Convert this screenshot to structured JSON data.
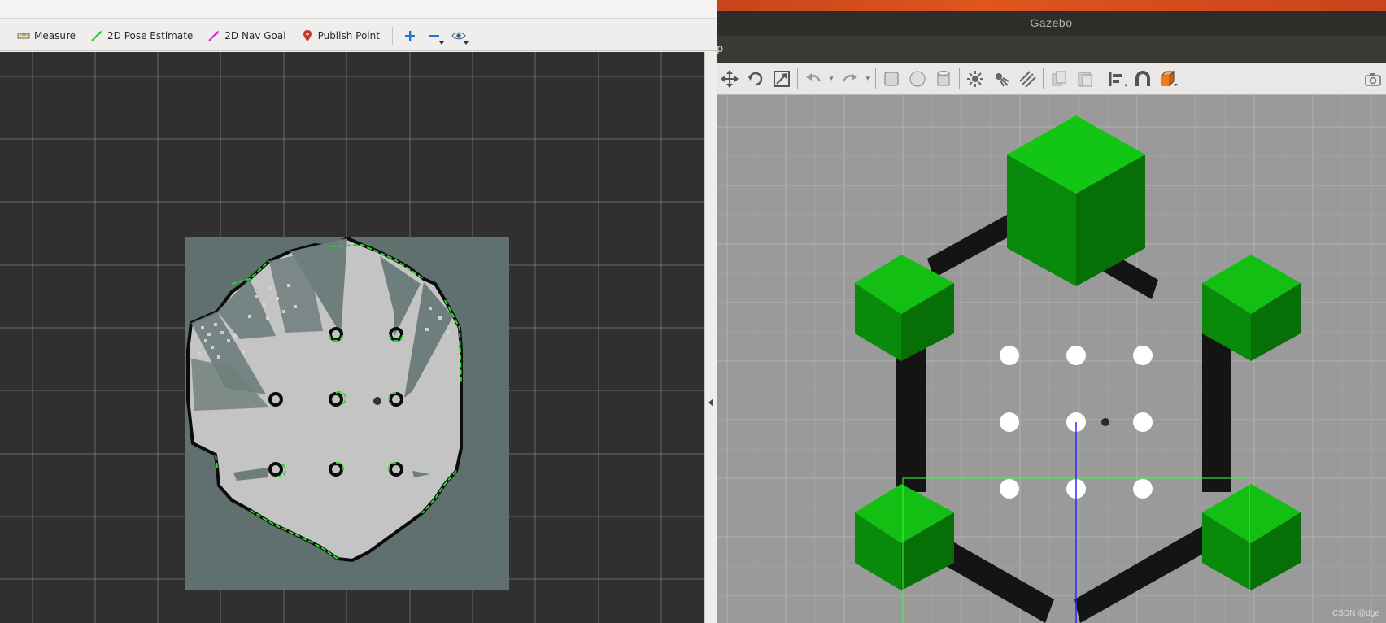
{
  "rviz": {
    "toolbar": {
      "measure": "Measure",
      "pose_estimate": "2D Pose Estimate",
      "nav_goal": "2D Nav Goal",
      "publish_point": "Publish Point",
      "zoom_in_icon": "plus-icon",
      "zoom_out_icon": "minus-icon",
      "view_icon": "eye-icon"
    },
    "colors": {
      "view_background": "#303030",
      "map_unknown": "#5f706e",
      "map_free": "#c4c4c4",
      "map_occupied": "#000000",
      "laser_scan": "#22dd22"
    }
  },
  "gazebo": {
    "title": "Gazebo",
    "menu_fragment": "p",
    "colors": {
      "viewport": "#9a9a9a",
      "cube": "#0aa80a",
      "wall": "#141414",
      "cylinder": "#ffffff"
    },
    "watermark": "CSDN @dge"
  }
}
